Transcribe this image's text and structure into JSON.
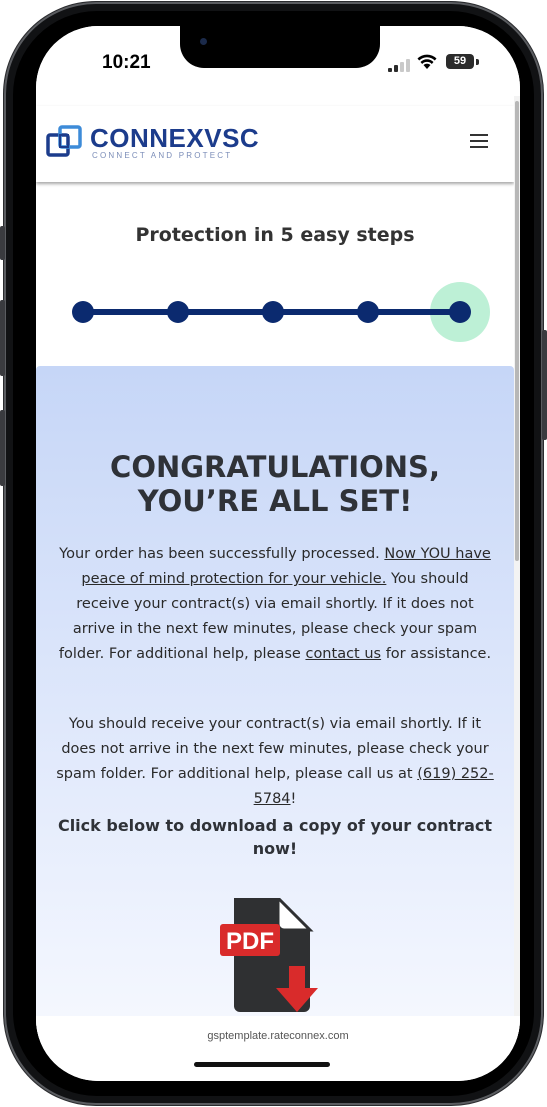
{
  "status_bar": {
    "time": "10:21",
    "battery": "59",
    "icons": [
      "signal-icon",
      "wifi-icon",
      "battery-icon"
    ]
  },
  "header": {
    "logo_brand": "CONNEX",
    "logo_brand_suffix": "VSC",
    "logo_tagline": "CONNECT AND PROTECT",
    "menu_icon": "hamburger-menu-icon"
  },
  "steps": {
    "title": "Protection in 5 easy steps",
    "total": 5,
    "current": 5
  },
  "confirmation": {
    "title_line1": "CONGRATULATIONS,",
    "title_line2": "YOU’RE ALL SET!",
    "para1_a": "Your order has been successfully processed. ",
    "para1_link1": "Now YOU have peace of mind protection for your vehicle.",
    "para1_b": " You should receive your contract(s) via email shortly. If it does not arrive in the next few minutes, please check your spam folder. For additional help, please ",
    "para1_link2": "contact us",
    "para1_c": " for assistance.",
    "para2_a": "You should receive your contract(s) via email shortly. If it does not arrive in the next few minutes, please check your spam folder. For additional help, please call us at ",
    "para2_phone": "(619) 252-5784",
    "para2_b": "!",
    "download_prompt": "Click below to download a copy of your contract now!",
    "pdf_label": "PDF"
  },
  "browser": {
    "url": "gsptemplate.rateconnex.com"
  },
  "colors": {
    "brand_blue": "#1c3c8c",
    "step_navy": "#0b2a6f",
    "active_halo": "#bdf0d6",
    "pdf_red": "#d92b2b"
  }
}
